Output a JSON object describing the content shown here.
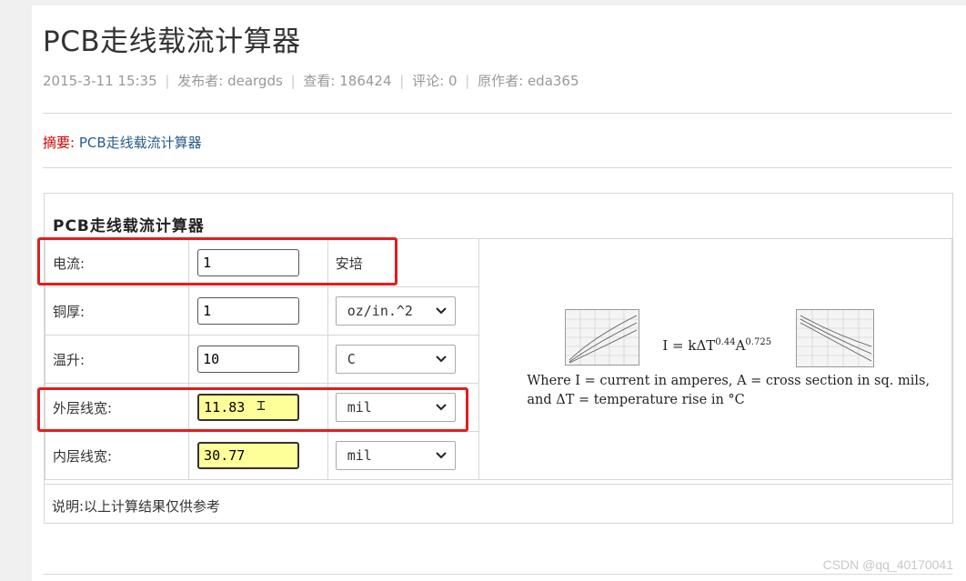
{
  "article": {
    "title": "PCB走线载流计算器",
    "meta": {
      "date": "2015-3-11 15:35",
      "publisher": "发布者: deargds",
      "views": "查看: 186424",
      "comments": "评论: 0",
      "author": "原作者: eda365",
      "separator": "|"
    },
    "summary": {
      "label": "摘要:",
      "text": "PCB走线载流计算器"
    }
  },
  "calculator": {
    "title": "PCB走线载流计算器",
    "rows": [
      {
        "label": "电流:",
        "value": "1",
        "unit_text": "安培"
      },
      {
        "label": "铜厚:",
        "value": "1",
        "unit_select": "oz/in.^2"
      },
      {
        "label": "温升:",
        "value": "10",
        "unit_select": "C"
      },
      {
        "label": "外层线宽:",
        "value": "11.83",
        "unit_select": "mil"
      },
      {
        "label": "内层线宽:",
        "value": "30.77",
        "unit_select": "mil"
      }
    ],
    "formula": {
      "main_prefix": "I = kΔT",
      "exp1": "0.44",
      "main_mid": "A",
      "exp2": "0.725",
      "desc_line1": "Where I = current in amperes, A = cross section in sq. mils,",
      "desc_line2": "and ΔT = temperature rise in °C"
    },
    "note": "说明:以上计算结果仅供参考"
  },
  "watermark": "CSDN @qq_40170041",
  "colors": {
    "highlight": "#e01e1e",
    "result_bg": "#ffff99",
    "summary_label": "#d00000"
  }
}
